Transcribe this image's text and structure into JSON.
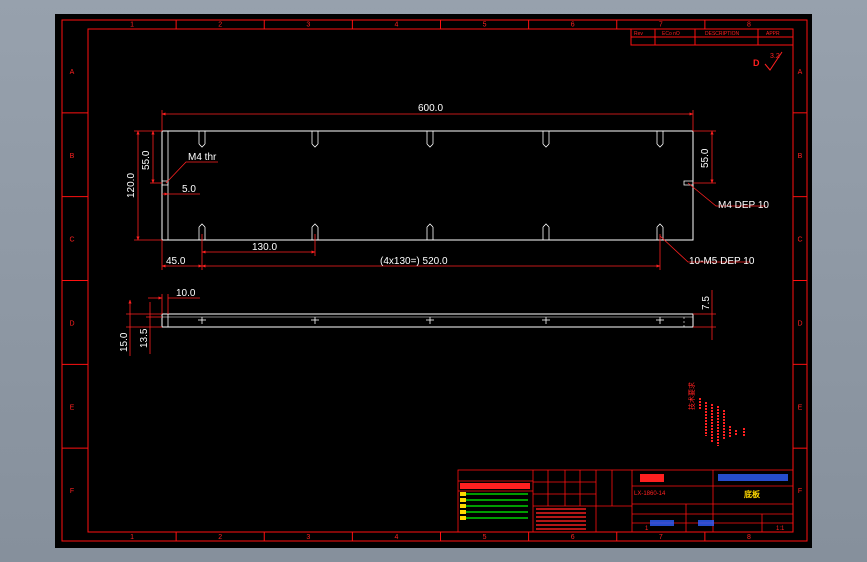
{
  "colors": {
    "background": "#000000",
    "frame": "#ff1010",
    "part": "#ffffff",
    "dimension": "#ff2020",
    "dim_text": "#ffffff",
    "title_yellow": "#ffd800",
    "title_green": "#00d000",
    "title_blue": "#3060ff"
  },
  "frame": {
    "col_labels": [
      "1",
      "2",
      "3",
      "4",
      "5",
      "6",
      "7",
      "8"
    ],
    "row_labels": [
      "A",
      "B",
      "C",
      "D",
      "E",
      "F"
    ]
  },
  "revision_table": {
    "headers": [
      "Rev",
      "ECo nO",
      "DESCRIPTION",
      "APPR"
    ]
  },
  "surface_note": "3.2",
  "view_top": {
    "dims": {
      "overall_length": "600.0",
      "width": "120.0",
      "half_left": "55.0",
      "half_right": "55.0",
      "edge_offset": "5.0",
      "pitch_first": "130.0",
      "first_hole": "45.0",
      "pattern": "(4x130=) 520.0"
    },
    "callouts": {
      "m4_thr": "M4 thr",
      "m4_dep": "M4 DEP 10",
      "m5_dep": "10-M5 DEP 10"
    }
  },
  "view_side": {
    "dims": {
      "top_offset": "10.0",
      "thickness": "15.0",
      "inner_height": "13.5",
      "right_height": "7.5"
    }
  },
  "notes_vertical": "技术要求",
  "title_block": {
    "drawing_number": "LX-1860-14",
    "part_name": "底板",
    "mark_1": "1",
    "scale": "1:1"
  }
}
